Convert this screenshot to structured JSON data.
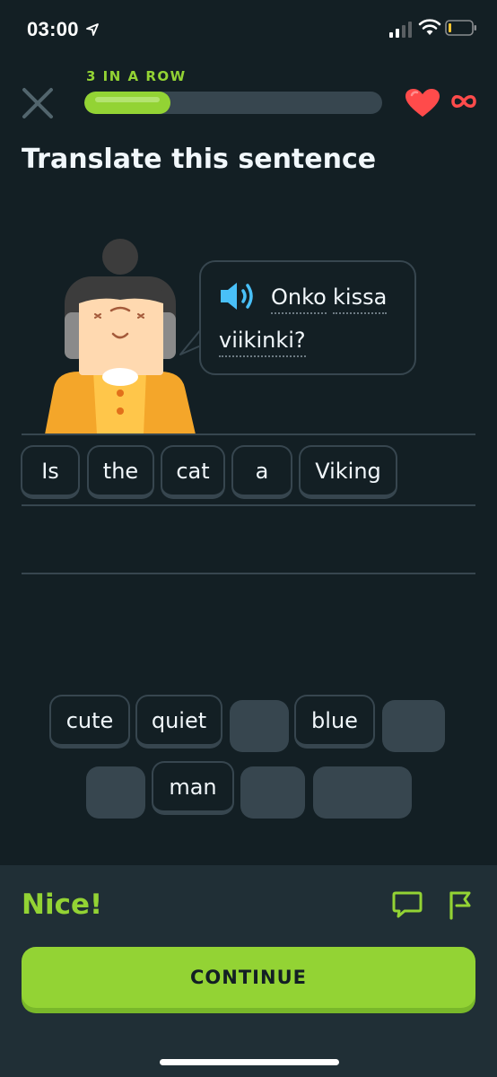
{
  "status_bar": {
    "time": "03:00",
    "icons": [
      "location-arrow-icon",
      "cellular-signal-icon",
      "wifi-icon",
      "battery-icon"
    ]
  },
  "header": {
    "streak_label": "3 IN A ROW",
    "progress_fraction": 0.29,
    "hearts": "∞",
    "icons": [
      "close-icon",
      "heart-icon",
      "infinity-icon"
    ]
  },
  "exercise": {
    "title": "Translate this sentence",
    "prompt_words": [
      "Onko",
      "kissa",
      "viikinki?"
    ],
    "icons": [
      "speaker-icon",
      "character-avatar"
    ]
  },
  "answer": {
    "tiles": [
      "Is",
      "the",
      "cat",
      "a",
      "Viking"
    ]
  },
  "word_bank": {
    "row1": [
      "cute",
      "quiet",
      "",
      "blue",
      ""
    ],
    "row2": [
      "",
      "man",
      "",
      ""
    ]
  },
  "feedback": {
    "message": "Nice!",
    "continue_label": "CONTINUE",
    "icons": [
      "comment-icon",
      "flag-icon"
    ]
  },
  "colors": {
    "background": "#131f24",
    "accent_green": "#93d334",
    "tile_border": "#37464f",
    "footer": "#202f36",
    "heart": "#ff4b4b",
    "speaker_blue": "#49c0f8"
  }
}
